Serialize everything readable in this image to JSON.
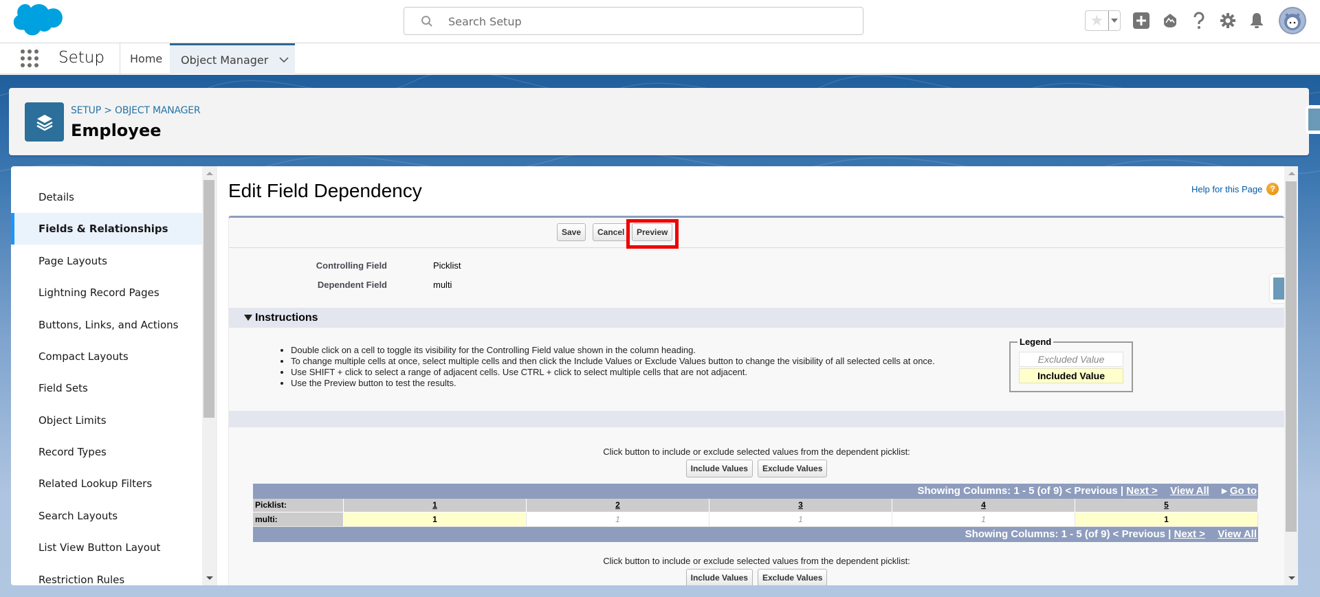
{
  "header": {
    "search_placeholder": "Search Setup",
    "icons": [
      "favorites-star-icon",
      "favorites-dropdown-icon",
      "global-add-icon",
      "trailhead-icon",
      "help-icon",
      "setup-gear-icon",
      "notifications-bell-icon",
      "user-avatar"
    ]
  },
  "nav": {
    "app_name": "Setup",
    "tabs": [
      {
        "label": "Home",
        "active": false
      },
      {
        "label": "Object Manager",
        "active": true
      }
    ]
  },
  "object": {
    "breadcrumb": "SETUP > OBJECT MANAGER",
    "title": "Employee"
  },
  "sidebar": {
    "items": [
      {
        "label": "Details",
        "active": false
      },
      {
        "label": "Fields & Relationships",
        "active": true
      },
      {
        "label": "Page Layouts",
        "active": false
      },
      {
        "label": "Lightning Record Pages",
        "active": false
      },
      {
        "label": "Buttons, Links, and Actions",
        "active": false
      },
      {
        "label": "Compact Layouts",
        "active": false
      },
      {
        "label": "Field Sets",
        "active": false
      },
      {
        "label": "Object Limits",
        "active": false
      },
      {
        "label": "Record Types",
        "active": false
      },
      {
        "label": "Related Lookup Filters",
        "active": false
      },
      {
        "label": "Search Layouts",
        "active": false
      },
      {
        "label": "List View Button Layout",
        "active": false
      },
      {
        "label": "Restriction Rules",
        "active": false
      }
    ]
  },
  "main": {
    "title": "Edit Field Dependency",
    "help_link": "Help for this Page",
    "buttons": {
      "save": "Save",
      "cancel": "Cancel",
      "preview": "Preview"
    },
    "fields": {
      "controlling_label": "Controlling Field",
      "controlling_value": "Picklist",
      "dependent_label": "Dependent Field",
      "dependent_value": "multi"
    },
    "instructions": {
      "heading": "Instructions",
      "items": [
        "Double click on a cell to toggle its visibility for the Controlling Field value shown in the column heading.",
        "To change multiple cells at once, select multiple cells and then click the Include Values or Exclude Values button to change the visibility of all selected cells at once.",
        "Use SHIFT + click to select a range of adjacent cells. Use CTRL + click to select multiple cells that are not adjacent.",
        "Use the Preview button to test the results."
      ]
    },
    "legend": {
      "title": "Legend",
      "excluded": "Excluded Value",
      "included": "Included Value"
    },
    "click_text": "Click button to include or exclude selected values from the dependent picklist:",
    "include_btn": "Include Values",
    "exclude_btn": "Exclude Values",
    "pager": {
      "showing": "Showing Columns: 1 - 5 (of 9)",
      "previous": "< Previous",
      "separator": "|",
      "next": "Next >",
      "view_all": "View All",
      "go_to": "Go to"
    },
    "table": {
      "controlling_label": "Picklist:",
      "dependent_label": "multi:",
      "columns": [
        "1",
        "2",
        "3",
        "4",
        "5"
      ],
      "cells": [
        {
          "value": "1",
          "included": true
        },
        {
          "value": "1",
          "included": false
        },
        {
          "value": "1",
          "included": false
        },
        {
          "value": "1",
          "included": false
        },
        {
          "value": "1",
          "included": true
        }
      ]
    }
  }
}
